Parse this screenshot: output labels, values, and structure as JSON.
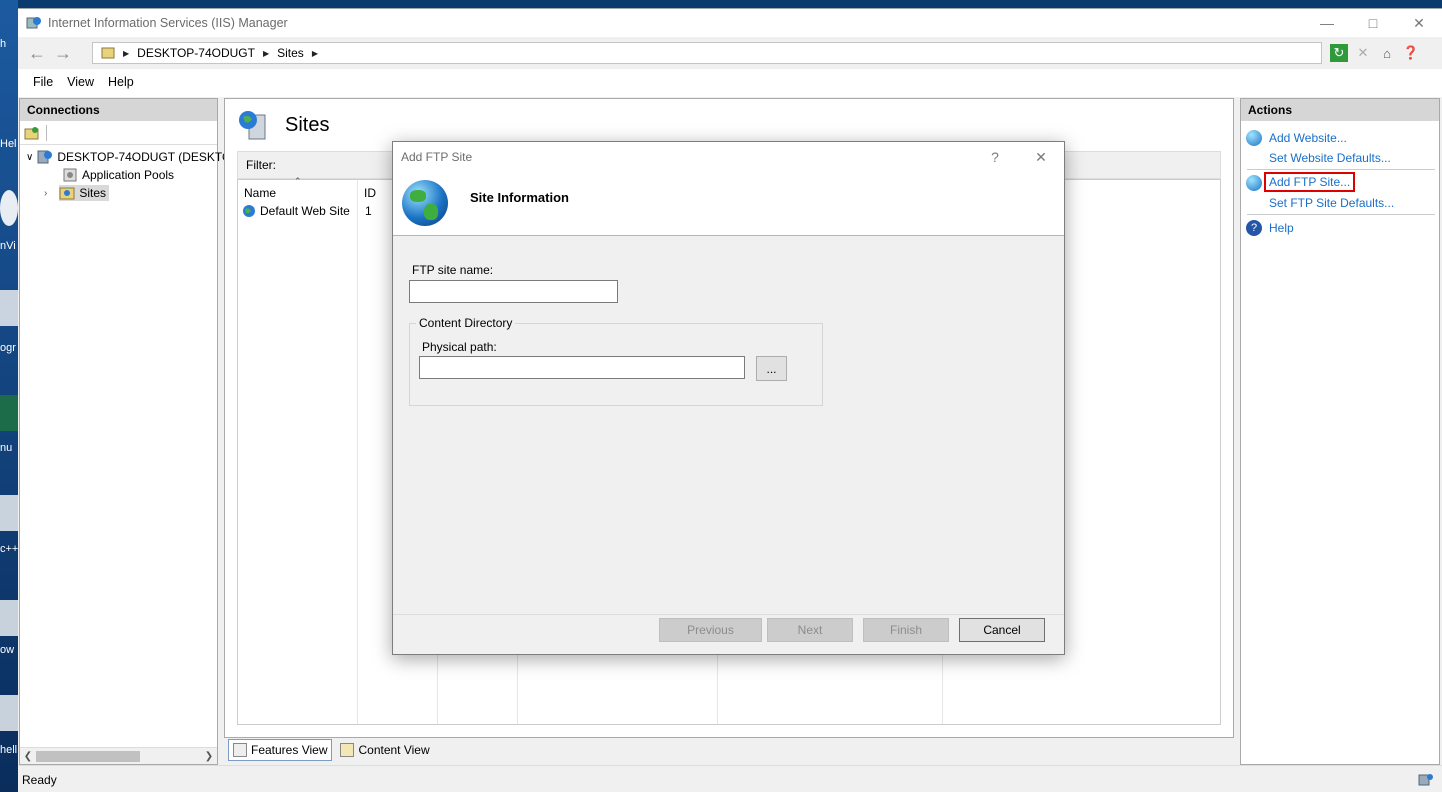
{
  "window": {
    "title": "Internet Information Services (IIS) Manager"
  },
  "desktop_labels": [
    "h",
    "Hel",
    "nVi",
    "ogr",
    "nu",
    "c++",
    "ow",
    "hell"
  ],
  "address": {
    "segments": [
      "DESKTOP-74ODUGT",
      "Sites"
    ]
  },
  "menu": [
    "File",
    "View",
    "Help"
  ],
  "connections": {
    "header": "Connections",
    "tree": [
      {
        "label": "DESKTOP-74ODUGT (DESKTO"
      },
      {
        "label": "Application Pools"
      },
      {
        "label": "Sites"
      }
    ]
  },
  "center": {
    "title": "Sites",
    "filter_label": "Filter:",
    "columns": [
      "Name",
      "ID"
    ],
    "rows": [
      {
        "name": "Default Web Site",
        "id": "1"
      }
    ]
  },
  "view_tabs": [
    "Features View",
    "Content View"
  ],
  "actions": {
    "header": "Actions",
    "items": [
      {
        "label": "Add Website..."
      },
      {
        "label": "Set Website Defaults..."
      },
      {
        "label": "Add FTP Site..."
      },
      {
        "label": "Set FTP Site Defaults..."
      },
      {
        "label": "Help"
      }
    ],
    "highlight_color": "#d00000",
    "link_color": "#1a6fc8"
  },
  "status": {
    "text": "Ready"
  },
  "dialog": {
    "title": "Add FTP Site",
    "help": "?",
    "heading": "Site Information",
    "site_name_label": "FTP site name:",
    "site_name_value": "",
    "group_label": "Content Directory",
    "physical_path_label": "Physical path:",
    "physical_path_value": "",
    "browse_label": "...",
    "buttons": {
      "previous": "Previous",
      "next": "Next",
      "finish": "Finish",
      "cancel": "Cancel"
    }
  }
}
